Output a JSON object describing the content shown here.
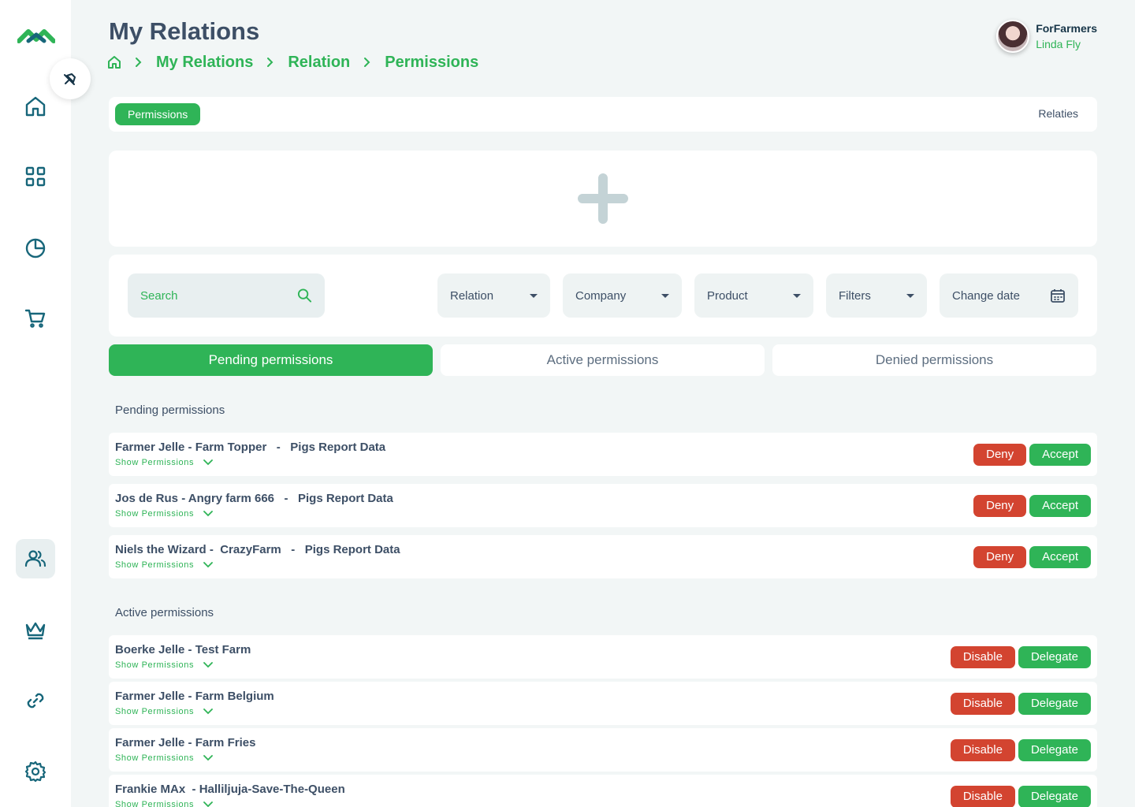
{
  "header": {
    "title": "My Relations",
    "breadcrumb": [
      "My Relations",
      "Relation",
      "Permissions"
    ]
  },
  "user": {
    "company": "ForFarmers",
    "name": "Linda Fly"
  },
  "tabstrip": {
    "active_tab": "Permissions",
    "right_tab": "Relaties"
  },
  "filters": {
    "search_placeholder": "Search",
    "relation": "Relation",
    "company": "Company",
    "product": "Product",
    "filters": "Filters",
    "change_date": "Change date"
  },
  "permission_tabs": [
    "Pending permissions",
    "Active permissions",
    "Denied permissions"
  ],
  "pending": {
    "label": "Pending permissions",
    "show_label": "Show Permissions",
    "deny_label": "Deny",
    "accept_label": "Accept",
    "items": [
      "Farmer Jelle - Farm Topper   -   Pigs Report Data",
      "Jos de Rus - Angry farm 666   -   Pigs Report Data",
      "Niels the Wizard -  CrazyFarm   -   Pigs Report Data"
    ]
  },
  "active": {
    "label": "Active permissions",
    "show_label": "Show Permissions",
    "disable_label": "Disable",
    "delegate_label": "Delegate",
    "items": [
      "Boerke Jelle - Test Farm",
      "Farmer Jelle - Farm Belgium",
      "Farmer Jelle - Farm Fries",
      "Frankie MAx  - Halliljuja-Save-The-Queen"
    ]
  },
  "colors": {
    "primary_green": "#2fb457",
    "danger_red": "#d34430",
    "background": "#f2f6f6",
    "text_dark": "#3d4f66"
  },
  "icons": {
    "sidebar": [
      "logo-icon",
      "home-icon",
      "grid-icon",
      "pie-chart-icon",
      "cart-icon",
      "users-icon",
      "crown-icon",
      "link-icon",
      "settings-icon"
    ],
    "collapse": "pin-icon"
  }
}
